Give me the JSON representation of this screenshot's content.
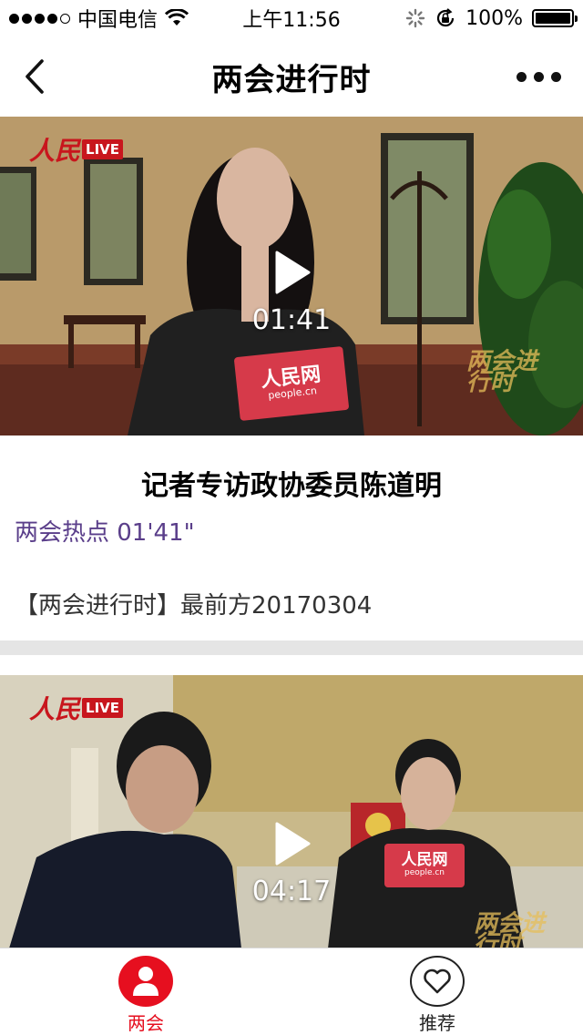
{
  "status_bar": {
    "carrier": "中国电信",
    "time": "上午11:56",
    "battery": "100%",
    "battery_level": 1.0
  },
  "nav": {
    "title": "两会进行时",
    "back_icon": "chevron-left-icon",
    "more_icon": "more-dots-icon"
  },
  "feed": [
    {
      "duration": "01:41",
      "title": "记者专访政协委员陈道明",
      "meta": "两会热点 01'41\"",
      "description": "【两会进行时】最前方20170304",
      "logo_text": "人民",
      "live_label": "LIVE",
      "mic_brand": "人民网",
      "mic_url": "people.cn",
      "watermark": "两会进行时"
    },
    {
      "duration": "04:17",
      "logo_text": "人民",
      "live_label": "LIVE",
      "mic_brand": "人民网",
      "mic_url": "people.cn",
      "watermark": "两会进行时"
    }
  ],
  "tabs": [
    {
      "label": "两会",
      "icon": "person-icon",
      "active": true
    },
    {
      "label": "推荐",
      "icon": "heart-icon",
      "active": false
    }
  ],
  "colors": {
    "accent_red": "#e60f1f",
    "meta_purple": "#5a3e8a",
    "separator": "#e5e5e5"
  }
}
